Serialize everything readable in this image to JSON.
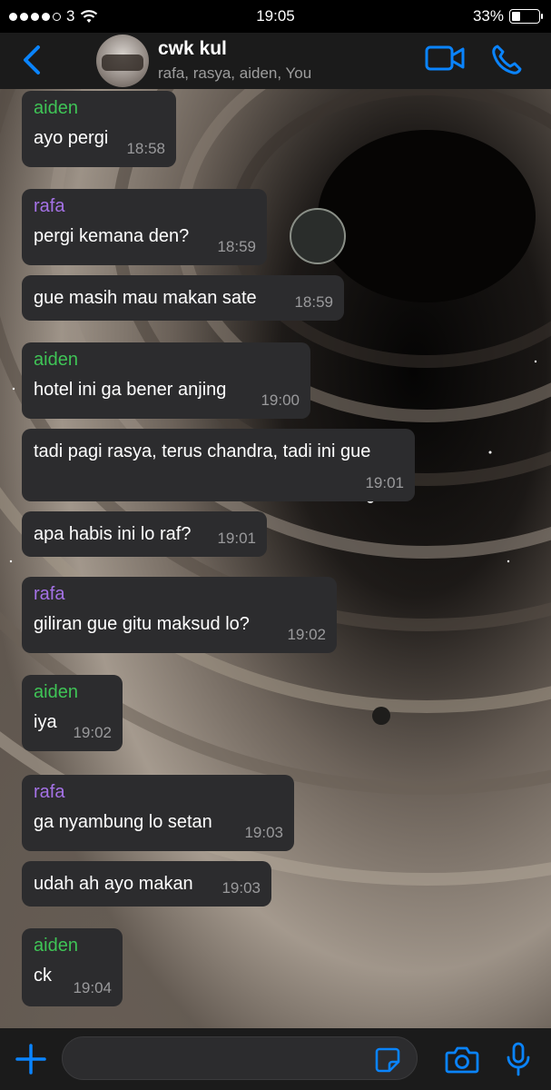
{
  "status_bar": {
    "carrier": "3",
    "time": "19:05",
    "battery": "33%",
    "battery_level": 0.33
  },
  "header": {
    "title": "cwk kul",
    "members": "rafa, rasya, aiden, You"
  },
  "messages": [
    {
      "sender": "aiden",
      "text": "ayo pergi",
      "time": "18:58"
    },
    {
      "sender": "rafa",
      "text": "pergi kemana den?",
      "time": "18:59"
    },
    {
      "sender": "",
      "text": "gue masih mau makan sate",
      "time": "18:59"
    },
    {
      "sender": "aiden",
      "text": "hotel ini ga bener anjing",
      "time": "19:00"
    },
    {
      "sender": "",
      "text": "tadi pagi rasya, terus chandra, tadi ini gue",
      "time": "19:01"
    },
    {
      "sender": "",
      "text": "apa habis ini lo raf?",
      "time": "19:01"
    },
    {
      "sender": "rafa",
      "text": "giliran gue gitu maksud lo?",
      "time": "19:02"
    },
    {
      "sender": "aiden",
      "text": "iya",
      "time": "19:02"
    },
    {
      "sender": "rafa",
      "text": "ga nyambung lo setan",
      "time": "19:03"
    },
    {
      "sender": "",
      "text": "udah ah ayo makan",
      "time": "19:03"
    },
    {
      "sender": "aiden",
      "text": "ck",
      "time": "19:04"
    }
  ],
  "input": {
    "value": ""
  },
  "colors": {
    "accent": "#0a84ff",
    "aiden": "#3fc456",
    "rafa": "#a572e6",
    "bubble": "#2c2c2e"
  }
}
